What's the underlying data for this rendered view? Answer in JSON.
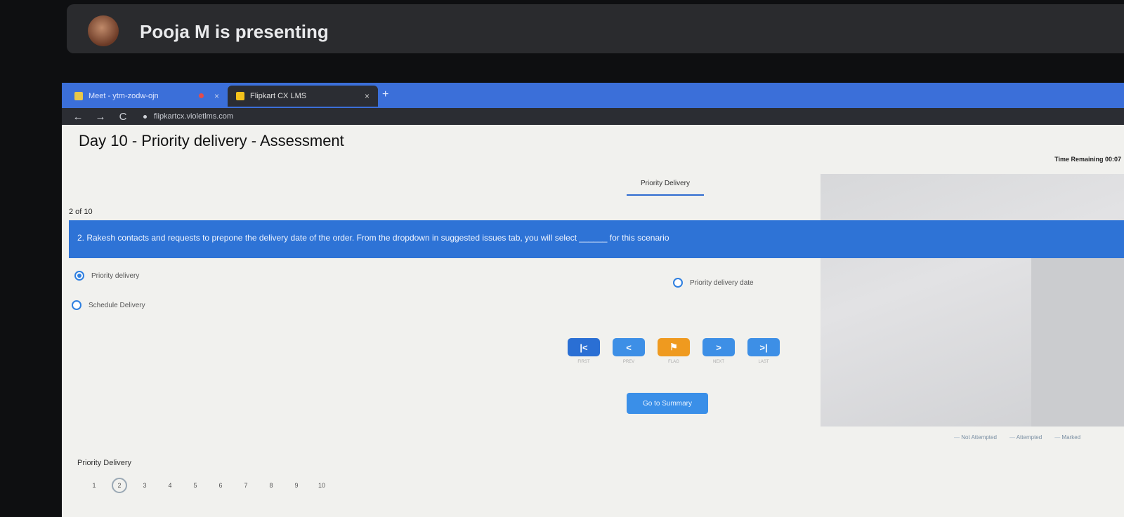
{
  "presenter": {
    "text": "Pooja M is presenting"
  },
  "browser": {
    "tabs": [
      {
        "label": "Meet - ytm-zodw-ojn",
        "close": "×"
      },
      {
        "label": "Flipkart CX LMS",
        "close": "×"
      }
    ],
    "new_tab": "+",
    "nav": {
      "back": "←",
      "forward": "→",
      "reload": "C"
    },
    "url": "flipkartcx.violetlms.com"
  },
  "page": {
    "title": "Day 10 - Priority delivery - Assessment",
    "timer": "Time Remaining 00:07",
    "section_tab": "Priority Delivery",
    "progress": "2 of 10",
    "question": "2. Rakesh contacts and requests to prepone the delivery date of the order. From the dropdown in suggested issues tab, you will select ______ for this scenario",
    "options": [
      {
        "label": "Priority delivery",
        "selected": true
      },
      {
        "label": "Priority delivery date",
        "selected": false
      },
      {
        "label": "Schedule Delivery",
        "selected": false
      }
    ],
    "nav_buttons": [
      {
        "symbol": "|<",
        "caption": "FIRST"
      },
      {
        "symbol": "<",
        "caption": "PREV"
      },
      {
        "symbol": "⚑",
        "caption": "FLAG"
      },
      {
        "symbol": ">",
        "caption": "NEXT"
      },
      {
        "symbol": ">|",
        "caption": "LAST"
      }
    ],
    "summary_button": "Go to Summary",
    "legend": [
      "Not Attempted",
      "Attempted",
      "Marked"
    ],
    "bottom_label": "Priority Delivery",
    "page_numbers": [
      "1",
      "2",
      "3",
      "4",
      "5",
      "6",
      "7",
      "8",
      "9",
      "10"
    ],
    "current_page": "2"
  }
}
